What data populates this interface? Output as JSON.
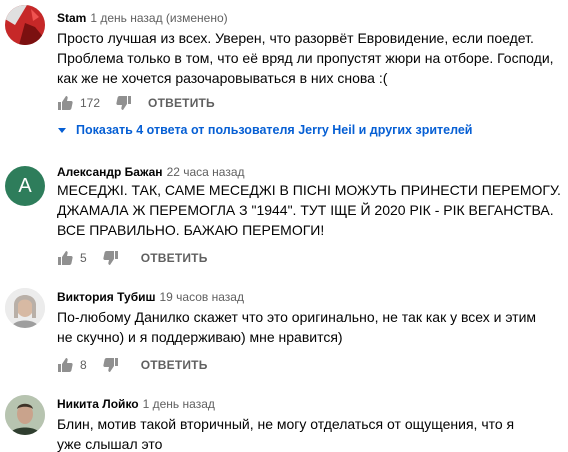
{
  "comments": [
    {
      "author": "Stam",
      "time": "1 день назад (изменено)",
      "text": "Просто лучшая из всех. Уверен, что разорвёт Евровидение, если поедет. Проблема только в том, что её вряд ли пропустят жюри на отборе. Господи, как же не хочется разочаровываться в них снова :(",
      "likes": "172",
      "reply_label": "ОТВЕТИТЬ",
      "view_replies": "Показать 4 ответа от пользователя Jerry Heil и других зрителей"
    },
    {
      "author": "Александр Бажан",
      "time": "22 часа назад",
      "avatar_letter": "А",
      "text": "МЕСЕДЖІ. ТАК, САМЕ МЕСЕДЖІ В ПІСНІ МОЖУТЬ ПРИНЕСТИ ПЕРЕМОГУ. ДЖАМАЛА Ж ПЕРЕМОГЛА З \"1944\". ТУТ ІЩЕ Й 2020 РІК - РІК ВЕГАНСТВА. ВСЕ ПРАВИЛЬНО. БАЖАЮ ПЕРЕМОГИ!",
      "likes": "5",
      "reply_label": "ОТВЕТИТЬ"
    },
    {
      "author": "Виктория Тубиш",
      "time": "19 часов назад",
      "text": "По-любому Данилко скажет что это оригинально, не так как у всех и этим не скучно) и я поддерживаю) мне нравится)",
      "likes": "8",
      "reply_label": "ОТВЕТИТЬ"
    },
    {
      "author": "Никита Лойко",
      "time": "1 день назад",
      "text": "Блин, мотив такой вторичный, не могу отделаться от ощущения, что я уже слышал это"
    }
  ],
  "icons": {
    "like": "thumbs-up-icon",
    "dislike": "thumbs-down-icon",
    "expand": "caret-down-icon"
  },
  "colors": {
    "link_blue": "#065fd4",
    "secondary_text": "#606060",
    "avatar_green": "#2e7d5b",
    "avatar_red": "#c62828"
  }
}
